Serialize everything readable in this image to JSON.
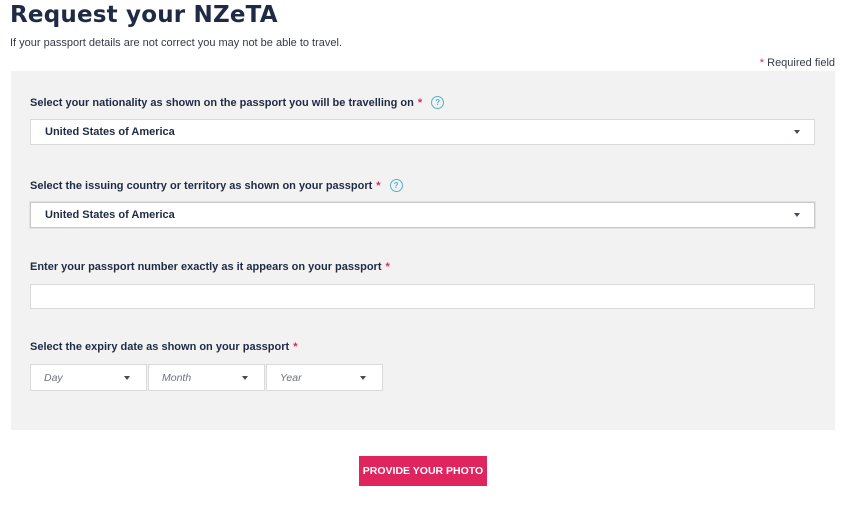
{
  "page": {
    "title": "Request your NZeTA",
    "subtitle": "If your passport details are not correct you may not be able to travel.",
    "required_note_star": "*",
    "required_note": "Required field"
  },
  "form": {
    "nationality": {
      "label": "Select your nationality as shown on the passport you will be travelling on",
      "required_marker": "*",
      "help_glyph": "?",
      "value": "United States of America"
    },
    "issuing_country": {
      "label": "Select the issuing country or territory as shown on your passport",
      "required_marker": "*",
      "help_glyph": "?",
      "value": "United States of America"
    },
    "passport_number": {
      "label": "Enter your passport number exactly as it appears on your passport",
      "required_marker": "*",
      "value": ""
    },
    "expiry_date": {
      "label": "Select the expiry date as shown on your passport",
      "required_marker": "*",
      "day_placeholder": "Day",
      "month_placeholder": "Month",
      "year_placeholder": "Year"
    }
  },
  "actions": {
    "provide_photo_label": "PROVIDE YOUR PHOTO"
  },
  "colors": {
    "accent": "#e0245e",
    "heading": "#1f2a44",
    "panel_bg": "#f2f2f2",
    "help_icon": "#4fb2d6"
  }
}
